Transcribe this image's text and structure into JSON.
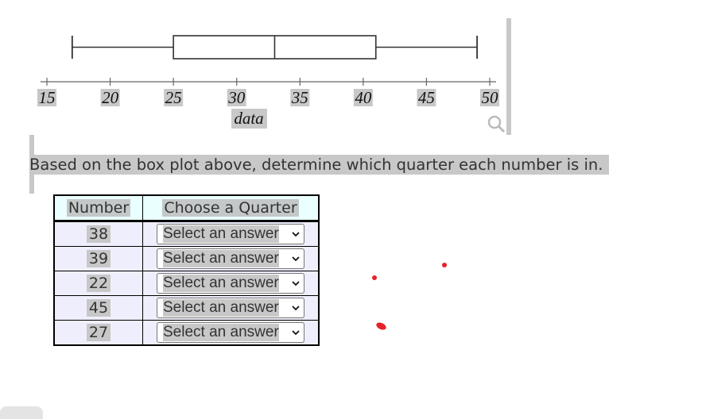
{
  "chart_data": {
    "type": "boxplot",
    "xlabel": "data",
    "xlim": [
      15,
      50
    ],
    "ticks": [
      15,
      20,
      25,
      30,
      35,
      40,
      45,
      50
    ],
    "tick_labels": [
      "15",
      "20",
      "25",
      "30",
      "35",
      "40",
      "45",
      "50"
    ],
    "box": {
      "min": 17,
      "q1": 25,
      "median": 33,
      "q3": 41,
      "max": 49
    },
    "grid": false
  },
  "prompt": "Based on the box plot above, determine which quarter each number is in.",
  "table": {
    "headers": [
      "Number",
      "Choose a Quarter"
    ],
    "rows": [
      {
        "number": "38",
        "select": "Select an answer"
      },
      {
        "number": "39",
        "select": "Select an answer"
      },
      {
        "number": "22",
        "select": "Select an answer"
      },
      {
        "number": "45",
        "select": "Select an answer"
      },
      {
        "number": "27",
        "select": "Select an answer"
      }
    ]
  },
  "icons": {
    "zoom": "magnifier-icon",
    "dropdown": "chevron-down-icon"
  },
  "colors": {
    "annotation_red": "#e8202a",
    "highlight_gray": "#c8c8c8"
  }
}
